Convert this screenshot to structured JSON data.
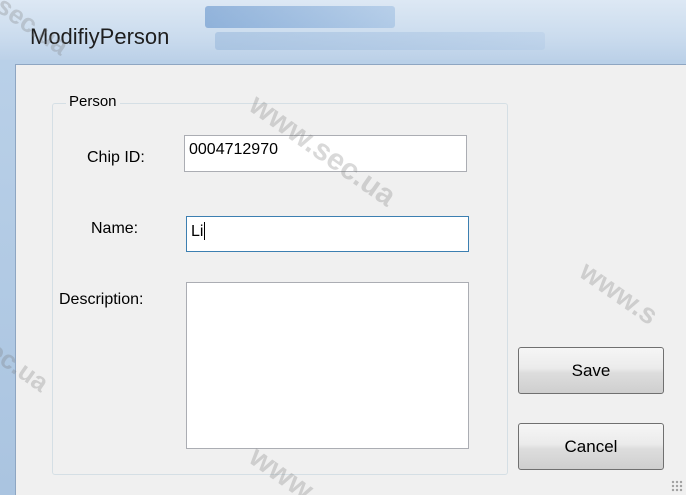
{
  "window": {
    "title": "ModifiyPerson"
  },
  "group": {
    "legend": "Person"
  },
  "fields": {
    "chip_id_label": "Chip ID:",
    "chip_id_value": "0004712970",
    "name_label": "Name:",
    "name_value": "Li",
    "description_label": "Description:",
    "description_value": ""
  },
  "buttons": {
    "save_label": "Save",
    "cancel_label": "Cancel"
  },
  "watermarks": {
    "text_main": "www.sec.ua",
    "text_top_left": "sec.ua",
    "text_left": "ec.ua",
    "text_right": "www.s",
    "text_bottom": "www."
  }
}
